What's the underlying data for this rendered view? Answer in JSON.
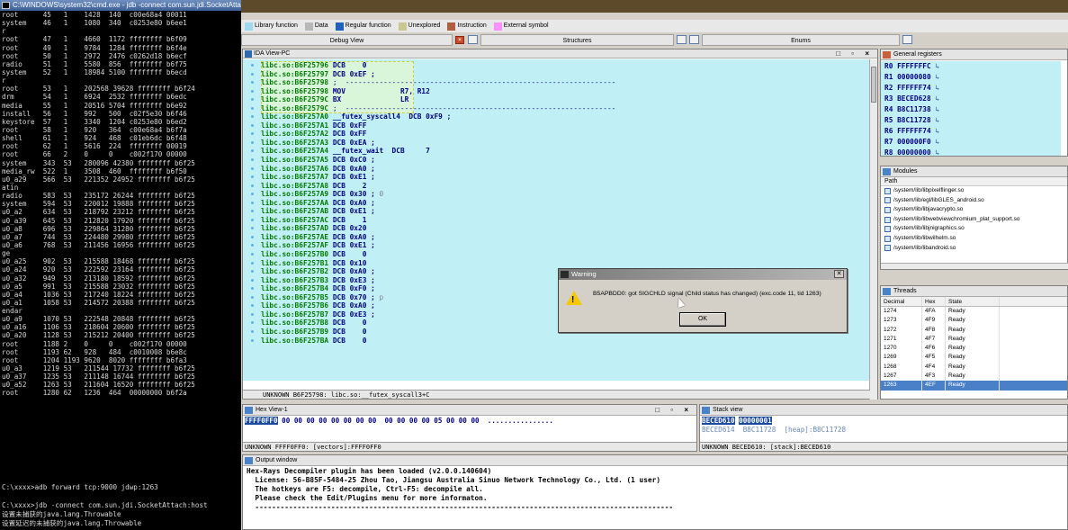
{
  "cmd": {
    "title": "C:\\WINDOWS\\system32\\cmd.exe - jdb -connect com.sun.jdi.SocketAttach",
    "rows": [
      "root      45   1    1428  140  c00e68a4 00011",
      "system    46   1    1080  340  c0253e80 b6ee1",
      "r",
      "root      47   1    4660  1172 ffffffff b6f09",
      "root      49   1    9784  1284 ffffffff b6f4e",
      "root      50   1    2972  2476 c0262d18 b6ecf",
      "radio     51   1    5580  856  ffffffff b6f75",
      "system    52   1    18984 5100 ffffffff b6ecd",
      "r",
      "root      53   1    202568 39628 ffffffff b6f24",
      "drm       54   1    6924  2532 ffffffff b6edc",
      "media     55   1    20516 5704 ffffffff b6e92",
      "install   56   1    992   500  c02f5e30 b6f46",
      "keystore  57   1    3340  1204 c0253e80 b6ed2",
      "root      58   1    920   364  c00e68a4 b6f7a",
      "shell     61   1    924   468  c01eb6dc b6f48",
      "root      62   1    5616  224  ffffffff 00019",
      "root      66   2    0     0    c002f170 00000",
      "system    343  53   280096 42380 ffffffff b6f25",
      "media_rw  522  1    3508  460  ffffffff b6f50",
      "u0_a29    566  53   221352 24952 ffffffff b6f25",
      "atin",
      "radio     583  53   235172 26244 ffffffff b6f25",
      "system    594  53   220012 19888 ffffffff b6f25",
      "u0_a2     634  53   218792 23212 ffffffff b6f25",
      "u0_a39    645  53   212820 17920 ffffffff b6f25",
      "u0_a8     696  53   229864 31280 ffffffff b6f25",
      "u0_a7     744  53   224480 29980 ffffffff b6f25",
      "u0_a6     768  53   211456 16956 ffffffff b6f25",
      "ge",
      "u0_a25    902  53   215588 18468 ffffffff b6f25",
      "u0_a24    920  53   222592 23164 ffffffff b6f25",
      "u0_a32    949  53   213180 18592 ffffffff b6f25",
      "u0_a5     991  53   215588 23032 ffffffff b6f25",
      "u0_a4     1036 53   217240 18224 ffffffff b6f25",
      "u0_a1     1058 53   214572 20388 ffffffff b6f25",
      "endar",
      "u0_a9     1070 53   222548 20848 ffffffff b6f25",
      "u0_a16    1106 53   218604 20600 ffffffff b6f25",
      "u0_a20    1128 53   215212 20400 ffffffff b6f25",
      "root      1188 2    0     0    c002f170 00000",
      "root      1193 62   928   484  c0010008 b6e8c",
      "root      1204 1193 9620  8020 ffffffff b6fa3",
      "u0_a3     1219 53   211544 17732 ffffffff b6f25",
      "u0_a37    1235 53   211148 16744 ffffffff b6f25",
      "u0_a52    1263 53   211604 16520 ffffffff b6f25",
      "root      1280 62   1236  464  00000000 b6f2a"
    ],
    "bottom": [
      "",
      "C:\\xxxx>adb forward tcp:9000 jdwp:1263",
      "",
      "C:\\xxxx>jdb -connect com.sun.jdi.SocketAttach:host",
      "设置未捕获的java.lang.Throwable",
      "设置延迟的未捕获的java.lang.Throwable"
    ]
  },
  "legend": [
    {
      "label": "Library function",
      "color": "#a0d8f0"
    },
    {
      "label": "Data",
      "color": "#b8b8b8"
    },
    {
      "label": "Regular function",
      "color": "#2060c0"
    },
    {
      "label": "Unexplored",
      "color": "#c8c890"
    },
    {
      "label": "Instruction",
      "color": "#b06040"
    },
    {
      "label": "External symbol",
      "color": "#ff90ff"
    }
  ],
  "tabs": {
    "debug_view": "Debug View",
    "structures": "Structures",
    "enums": "Enums"
  },
  "ida_view": {
    "title": "IDA View-PC",
    "status": "UNKNOWN B6F25798: libc.so:__futex_syscall3+C",
    "lines": [
      {
        "addr": "libc.so:B6F25796",
        "op": "DCB",
        "arg": "   0",
        "cm": ""
      },
      {
        "addr": "libc.so:B6F25797",
        "op": "DCB",
        "arg": "0xEF ;",
        "cm": ""
      },
      {
        "addr": "libc.so:B6F25798",
        "op": ";",
        "arg": " ----------------------------------------------------------------",
        "cm": ""
      },
      {
        "addr": "libc.so:B6F25798",
        "op": "MOV",
        "arg": "            R7, R12",
        "cm": ""
      },
      {
        "addr": "libc.so:B6F2579C",
        "op": "BX",
        "arg": "             LR",
        "cm": ""
      },
      {
        "addr": "libc.so:B6F2579C",
        "op": ";",
        "arg": " ----------------------------------------------------------------",
        "cm": ""
      },
      {
        "addr": "libc.so:B6F257A0",
        "op": "__futex_syscall4",
        "arg": " DCB 0xF9 ;",
        "cm": ""
      },
      {
        "addr": "libc.so:B6F257A1",
        "op": "DCB",
        "arg": "0xFF",
        "cm": ""
      },
      {
        "addr": "libc.so:B6F257A2",
        "op": "DCB",
        "arg": "0xFF",
        "cm": ""
      },
      {
        "addr": "libc.so:B6F257A3",
        "op": "DCB",
        "arg": "0xEA ;",
        "cm": ""
      },
      {
        "addr": "libc.so:B6F257A4",
        "op": "__futex_wait",
        "arg": " DCB     7",
        "cm": ""
      },
      {
        "addr": "libc.so:B6F257A5",
        "op": "DCB",
        "arg": "0xC0 ;",
        "cm": ""
      },
      {
        "addr": "libc.so:B6F257A6",
        "op": "DCB",
        "arg": "0xA0 ;",
        "cm": ""
      },
      {
        "addr": "libc.so:B6F257A7",
        "op": "DCB",
        "arg": "0xE1 ;",
        "cm": ""
      },
      {
        "addr": "libc.so:B6F257A8",
        "op": "DCB",
        "arg": "   2",
        "cm": ""
      },
      {
        "addr": "libc.so:B6F257A9",
        "op": "DCB",
        "arg": "0x30 ;",
        "cm": " 0"
      },
      {
        "addr": "libc.so:B6F257AA",
        "op": "DCB",
        "arg": "0xA0 ;",
        "cm": ""
      },
      {
        "addr": "libc.so:B6F257AB",
        "op": "DCB",
        "arg": "0xE1 ;",
        "cm": ""
      },
      {
        "addr": "libc.so:B6F257AC",
        "op": "DCB",
        "arg": "   1",
        "cm": ""
      },
      {
        "addr": "libc.so:B6F257AD",
        "op": "DCB",
        "arg": "0x20",
        "cm": ""
      },
      {
        "addr": "libc.so:B6F257AE",
        "op": "DCB",
        "arg": "0xA0 ;",
        "cm": ""
      },
      {
        "addr": "libc.so:B6F257AF",
        "op": "DCB",
        "arg": "0xE1 ;",
        "cm": ""
      },
      {
        "addr": "libc.so:B6F257B0",
        "op": "DCB",
        "arg": "   0",
        "cm": ""
      },
      {
        "addr": "libc.so:B6F257B1",
        "op": "DCB",
        "arg": "0x10",
        "cm": ""
      },
      {
        "addr": "libc.so:B6F257B2",
        "op": "DCB",
        "arg": "0xA0 ;",
        "cm": ""
      },
      {
        "addr": "libc.so:B6F257B3",
        "op": "DCB",
        "arg": "0xE3 ;",
        "cm": ""
      },
      {
        "addr": "libc.so:B6F257B4",
        "op": "DCB",
        "arg": "0xF0 ;",
        "cm": ""
      },
      {
        "addr": "libc.so:B6F257B5",
        "op": "DCB",
        "arg": "0x70 ;",
        "cm": " p"
      },
      {
        "addr": "libc.so:B6F257B6",
        "op": "DCB",
        "arg": "0xA0 ;",
        "cm": ""
      },
      {
        "addr": "libc.so:B6F257B7",
        "op": "DCB",
        "arg": "0xE3 ;",
        "cm": ""
      },
      {
        "addr": "libc.so:B6F257B8",
        "op": "DCB",
        "arg": "   0",
        "cm": ""
      },
      {
        "addr": "libc.so:B6F257B9",
        "op": "DCB",
        "arg": "   0",
        "cm": ""
      },
      {
        "addr": "libc.so:B6F257BA",
        "op": "DCB",
        "arg": "   0",
        "cm": ""
      }
    ]
  },
  "registers": {
    "title": "General registers",
    "rows": [
      {
        "name": "R0",
        "value": "FFFFFFFC",
        "ref": "↳"
      },
      {
        "name": "R1",
        "value": "00000080",
        "ref": "↳"
      },
      {
        "name": "R2",
        "value": "FFFFFF74",
        "ref": "↳"
      },
      {
        "name": "R3",
        "value": "BECED628",
        "ref": "↳"
      },
      {
        "name": "R4",
        "value": "B8C11738",
        "ref": "↳"
      },
      {
        "name": "R5",
        "value": "B8C11728",
        "ref": "↳"
      },
      {
        "name": "R6",
        "value": "FFFFFF74",
        "ref": "↳"
      },
      {
        "name": "R7",
        "value": "000000F0",
        "ref": "↳"
      },
      {
        "name": "R8",
        "value": "00000000",
        "ref": "↳"
      }
    ]
  },
  "modules": {
    "title": "Modules",
    "col": "Path",
    "rows": [
      "/system/lib/libpixelflinger.so",
      "/system/lib/egl/libGLES_android.so",
      "/system/lib/libjavacrypto.so",
      "/system/lib/libwebviewchromium_plat_support.so",
      "/system/lib/libjnigraphics.so",
      "/system/lib/libwilhelm.so",
      "/system/lib/libandroid.so"
    ]
  },
  "threads": {
    "title": "Threads",
    "cols": [
      "Decimal",
      "Hex",
      "State"
    ],
    "rows": [
      [
        "1274",
        "4FA",
        "Ready"
      ],
      [
        "1273",
        "4F9",
        "Ready"
      ],
      [
        "1272",
        "4F8",
        "Ready"
      ],
      [
        "1271",
        "4F7",
        "Ready"
      ],
      [
        "1270",
        "4F6",
        "Ready"
      ],
      [
        "1269",
        "4F5",
        "Ready"
      ],
      [
        "1268",
        "4F4",
        "Ready"
      ],
      [
        "1267",
        "4F3",
        "Ready"
      ],
      [
        "1263",
        "4EF",
        "Ready"
      ]
    ]
  },
  "hex": {
    "title": "Hex View-1",
    "addr": "FFFF0FF0",
    "bytes": " 00 00 00 00 00 00 00 00  00 00 00 00 05 00 00 00  ................",
    "status": "UNKNOWN FFFF0FF0: [vectors]:FFFF0FF0"
  },
  "stack": {
    "title": "Stack view",
    "row1_addr": "BECED610",
    "row1_val": "00000001",
    "row2_addr": "BECED614",
    "row2_val": "B8C11728  [heap]:B8C11728",
    "status": "UNKNOWN BECED610: [stack]:BECED610"
  },
  "output": {
    "title": "Output window",
    "lines": [
      "Hex-Rays Decompiler plugin has been loaded (v2.0.0.140604)",
      "  License: 56-B85F-5484-25 Zhou Tao, Jiangsu Australia Sinuo Network Technology Co., Ltd. (1 user)",
      "  The hotkeys are F5: decompile, Ctrl-F5: decompile all.",
      "  Please check the Edit/Plugins menu for more informaton.",
      "  ---------------------------------------------------------------------------------------------------"
    ]
  },
  "warning": {
    "title": "Warning",
    "message": "B5APBDD0: got SIGCHLD signal (Child status has changed) (exc.code 11, tid 1263)",
    "ok": "OK"
  },
  "colors": {
    "asm_bg": "#c0f0f5",
    "addr_green": "#007a00",
    "navy": "#000080",
    "select_blue": "#1a4aa0"
  }
}
